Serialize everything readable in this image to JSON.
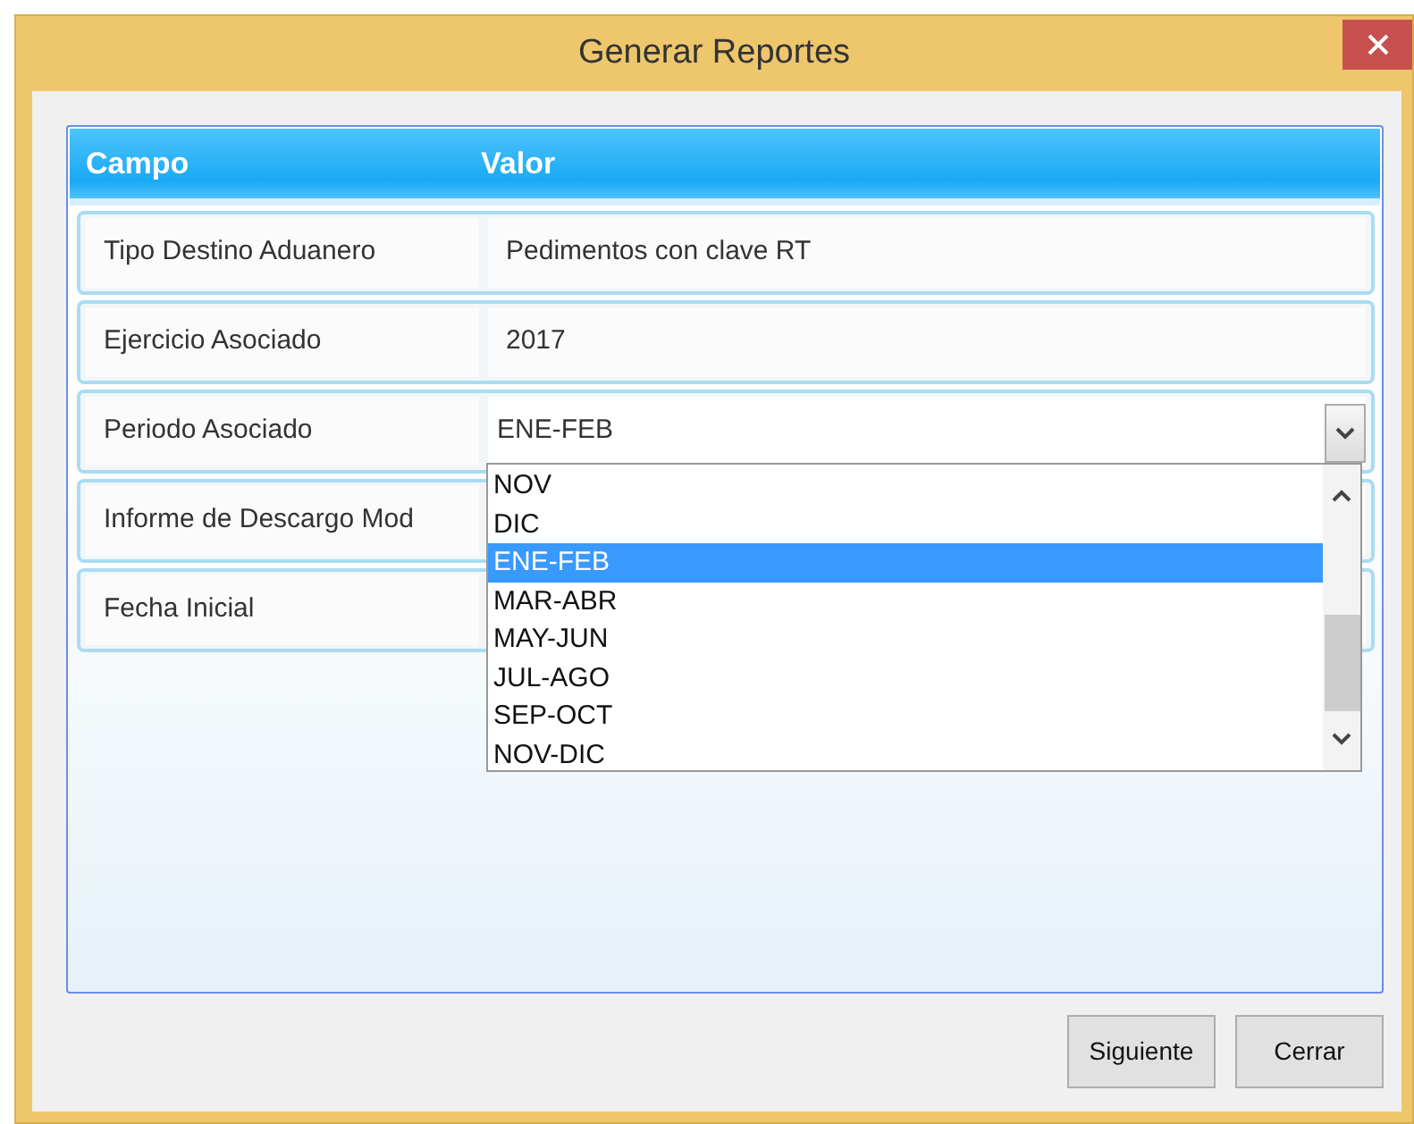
{
  "window": {
    "title": "Generar Reportes"
  },
  "table": {
    "columns": [
      "Campo",
      "Valor"
    ],
    "rows": [
      {
        "kind": "text",
        "field": "Tipo Destino Aduanero",
        "value": "Pedimentos con clave RT"
      },
      {
        "kind": "text",
        "field": "Ejercicio Asociado",
        "value": "2017"
      },
      {
        "kind": "combo",
        "field": "Periodo Asociado",
        "value": "ENE-FEB",
        "expanded": true,
        "options": [
          {
            "label": "NOV",
            "selected": false
          },
          {
            "label": "DIC",
            "selected": false
          },
          {
            "label": "ENE-FEB",
            "selected": true
          },
          {
            "label": "MAR-ABR",
            "selected": false
          },
          {
            "label": "MAY-JUN",
            "selected": false
          },
          {
            "label": "JUL-AGO",
            "selected": false
          },
          {
            "label": "SEP-OCT",
            "selected": false
          },
          {
            "label": "NOV-DIC",
            "selected": false
          }
        ]
      },
      {
        "kind": "text",
        "field": "Informe de Descargo Mod"
      },
      {
        "kind": "text",
        "field": "Fecha Inicial"
      }
    ]
  },
  "buttons": [
    "Siguiente",
    "Cerrar"
  ]
}
